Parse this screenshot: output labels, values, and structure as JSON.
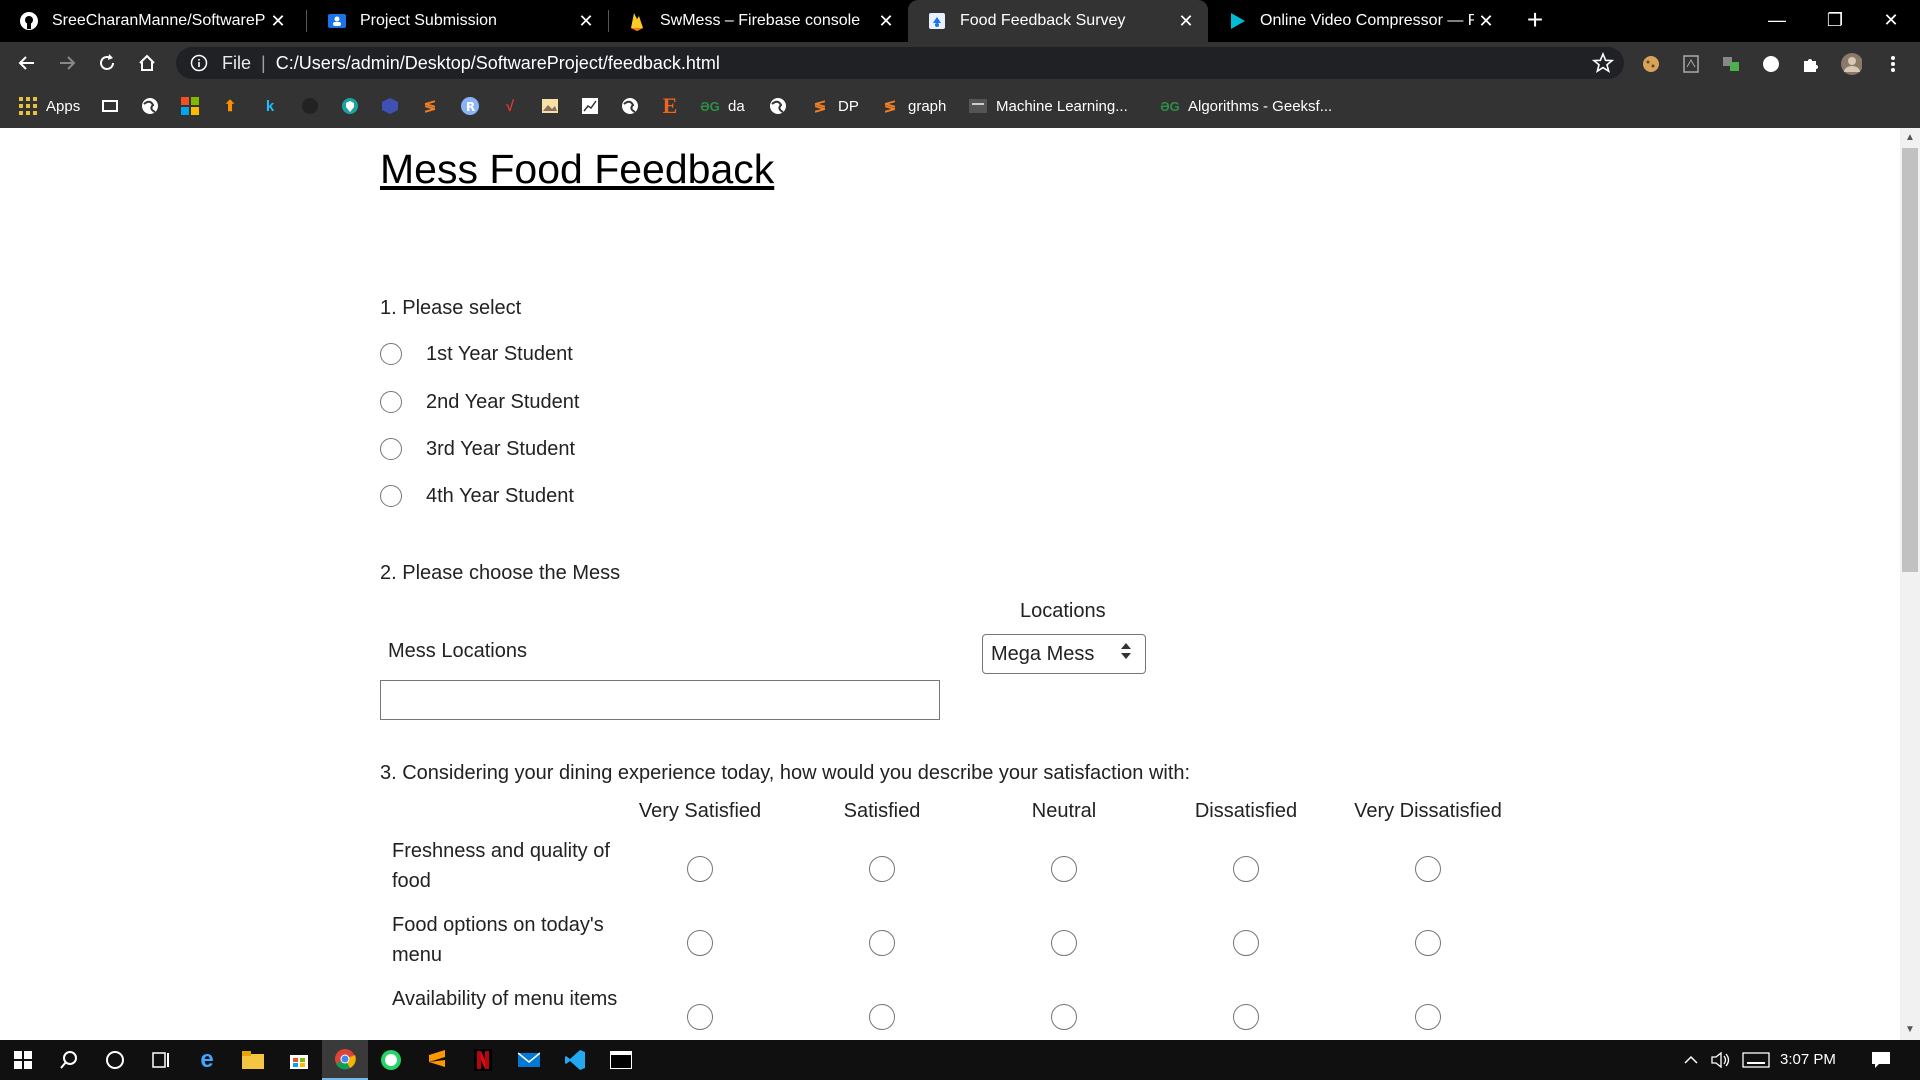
{
  "browser": {
    "tabs": [
      {
        "title": "SreeCharanManne/SoftwareProje",
        "icon": "github-icon",
        "active": false
      },
      {
        "title": "Project Submission",
        "icon": "classroom-icon",
        "active": false
      },
      {
        "title": "SwMess – Firebase console",
        "icon": "firebase-icon",
        "active": false
      },
      {
        "title": "Food Feedback Survey",
        "icon": "page-icon",
        "active": true
      },
      {
        "title": "Online Video Compressor — Red",
        "icon": "play-icon",
        "active": false
      }
    ],
    "new_tab": "+",
    "address": {
      "scheme_label": "File",
      "separator": "|",
      "url": "C:/Users/admin/Desktop/SoftwareProject/feedback.html"
    },
    "bookmarks": [
      {
        "label": "Apps",
        "icon": "apps-grid-icon"
      },
      {
        "label": "",
        "icon": "bookmark-icon"
      },
      {
        "label": "",
        "icon": "globe-icon"
      },
      {
        "label": "",
        "icon": "microsoft-icon"
      },
      {
        "label": "",
        "icon": "tensorflow-icon"
      },
      {
        "label": "",
        "icon": "k-icon"
      },
      {
        "label": "",
        "icon": "github-icon"
      },
      {
        "label": "",
        "icon": "shield-icon"
      },
      {
        "label": "",
        "icon": "cube-icon"
      },
      {
        "label": "",
        "icon": "stack-icon"
      },
      {
        "label": "",
        "icon": "r-icon"
      },
      {
        "label": "",
        "icon": "v-icon"
      },
      {
        "label": "",
        "icon": "image-icon"
      },
      {
        "label": "",
        "icon": "chart-icon"
      },
      {
        "label": "",
        "icon": "globe-icon"
      },
      {
        "label": "",
        "icon": "e-icon"
      },
      {
        "label": "da",
        "icon": "gfg-icon"
      },
      {
        "label": "",
        "icon": "globe-icon"
      },
      {
        "label": "DP",
        "icon": "stack-icon"
      },
      {
        "label": "graph",
        "icon": "stack-icon"
      },
      {
        "label": "Machine Learning...",
        "icon": "ml-icon"
      },
      {
        "label": "Algorithms - Geeksf...",
        "icon": "gfg-icon"
      }
    ]
  },
  "survey": {
    "title": "Mess Food Feedback",
    "q1": {
      "text": "1. Please select",
      "options": [
        "1st Year Student",
        "2nd Year Student",
        "3rd Year Student",
        "4th Year Student"
      ]
    },
    "q2": {
      "text": "2. Please choose the Mess",
      "select_caption": "Locations",
      "input_label": "Mess Locations",
      "input_value": "",
      "select_value": "Mega Mess"
    },
    "q3": {
      "text": "3. Considering your dining experience today, how would you describe your satisfaction with:",
      "columns": [
        "Very Satisfied",
        "Satisfied",
        "Neutral",
        "Dissatisfied",
        "Very Dissatisfied"
      ],
      "rows": [
        "Freshness and quality of food",
        "Food options on today's menu",
        "Availability of menu items"
      ]
    }
  },
  "taskbar": {
    "apps": [
      "windows-start-icon",
      "search-icon",
      "cortana-icon",
      "task-view-icon",
      "edge-icon",
      "file-explorer-icon",
      "store-icon",
      "chrome-icon",
      "whatsapp-icon",
      "sublime-icon",
      "netflix-icon",
      "mail-icon",
      "vscode-icon",
      "terminal-icon"
    ],
    "time": "3:07 PM"
  },
  "colors": {
    "chrome_dark": "#000000",
    "toolbar": "#333333",
    "taskbar": "#101010",
    "radio_border": "#767676"
  }
}
